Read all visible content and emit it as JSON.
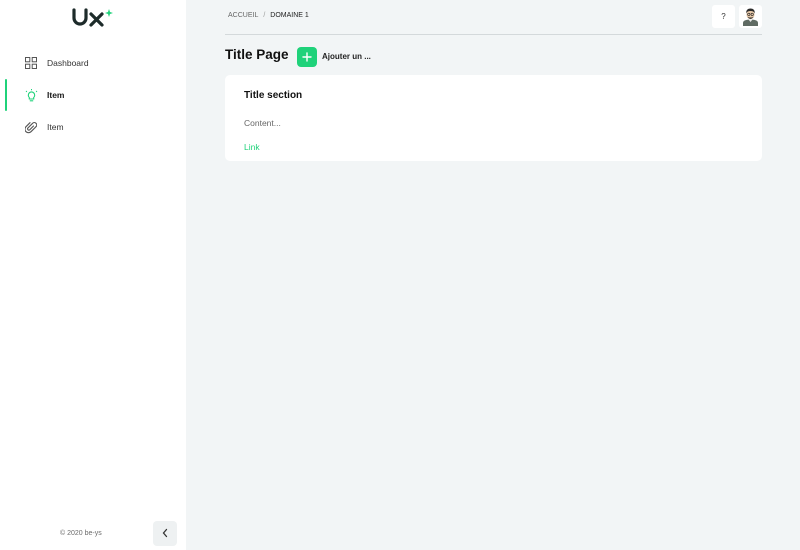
{
  "brand": {
    "logo_text": "ux",
    "accent_color": "#1fd27a",
    "logo_color": "#1d2b2a"
  },
  "sidebar": {
    "items": [
      {
        "label": "Dashboard",
        "icon": "grid-icon",
        "active": false
      },
      {
        "label": "Item",
        "icon": "lightbulb-icon",
        "active": true
      },
      {
        "label": "Item",
        "icon": "paperclip-icon",
        "active": false
      }
    ],
    "copyright": "© 2020 be-ys",
    "collapse_icon": "chevron-left-icon"
  },
  "header": {
    "breadcrumb": [
      "ACCUEIL",
      "DOMAINE 1"
    ],
    "breadcrumb_separator": "/",
    "help_label": "?",
    "avatar_icon": "user-avatar-icon"
  },
  "page": {
    "title": "Title Page",
    "add_button_label": "Ajouter un ..."
  },
  "card": {
    "title": "Title section",
    "content": "Content...",
    "link": "Link"
  }
}
